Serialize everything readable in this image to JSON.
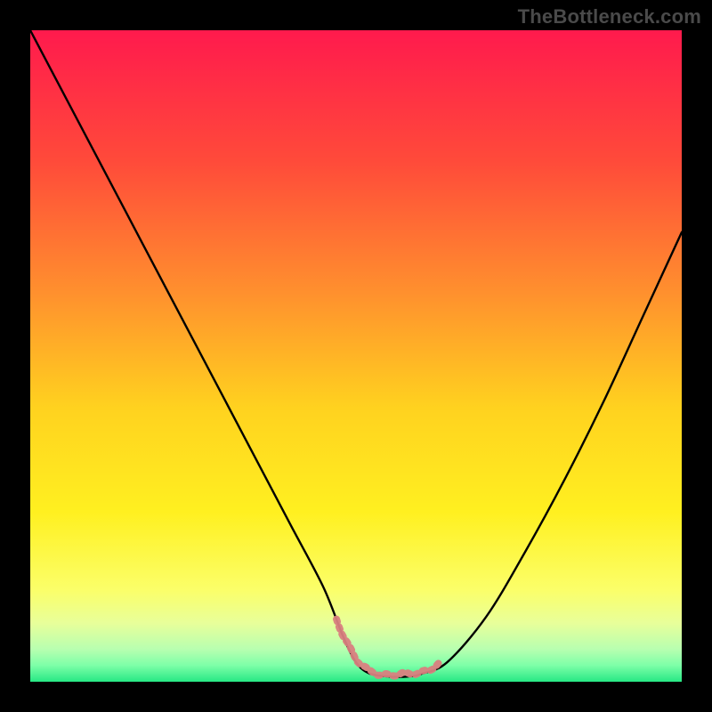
{
  "watermark": "TheBottleneck.com",
  "colors": {
    "frame": "#000000",
    "gradient_stops": [
      {
        "offset": 0.0,
        "color": "#ff1a4d"
      },
      {
        "offset": 0.2,
        "color": "#ff4a3a"
      },
      {
        "offset": 0.4,
        "color": "#ff8f2e"
      },
      {
        "offset": 0.58,
        "color": "#ffd21f"
      },
      {
        "offset": 0.74,
        "color": "#fff020"
      },
      {
        "offset": 0.86,
        "color": "#fbff6a"
      },
      {
        "offset": 0.91,
        "color": "#e8ff9a"
      },
      {
        "offset": 0.95,
        "color": "#b8ffb0"
      },
      {
        "offset": 0.975,
        "color": "#7dffa8"
      },
      {
        "offset": 1.0,
        "color": "#27e884"
      }
    ],
    "curve": "#000000",
    "highlight": "#d98080"
  },
  "chart_data": {
    "type": "line",
    "title": "",
    "xlabel": "",
    "ylabel": "",
    "xlim": [
      0,
      100
    ],
    "ylim": [
      0,
      100
    ],
    "grid": false,
    "series": [
      {
        "name": "bottleneck-curve",
        "x": [
          0,
          5,
          10,
          15,
          20,
          25,
          30,
          35,
          40,
          45,
          48,
          50,
          52,
          55,
          58,
          60,
          64,
          70,
          76,
          82,
          88,
          94,
          100
        ],
        "y": [
          100,
          90.5,
          81,
          71.5,
          62,
          52.5,
          43,
          33.5,
          24,
          14.5,
          7,
          3,
          1.3,
          0.8,
          0.8,
          1.2,
          3,
          10,
          20,
          31,
          43,
          56,
          69
        ]
      }
    ],
    "annotations": [
      {
        "name": "flat-bottom-highlight",
        "x_range": [
          47,
          63
        ],
        "style": "dotted-wavy",
        "color": "#d98080"
      }
    ]
  }
}
